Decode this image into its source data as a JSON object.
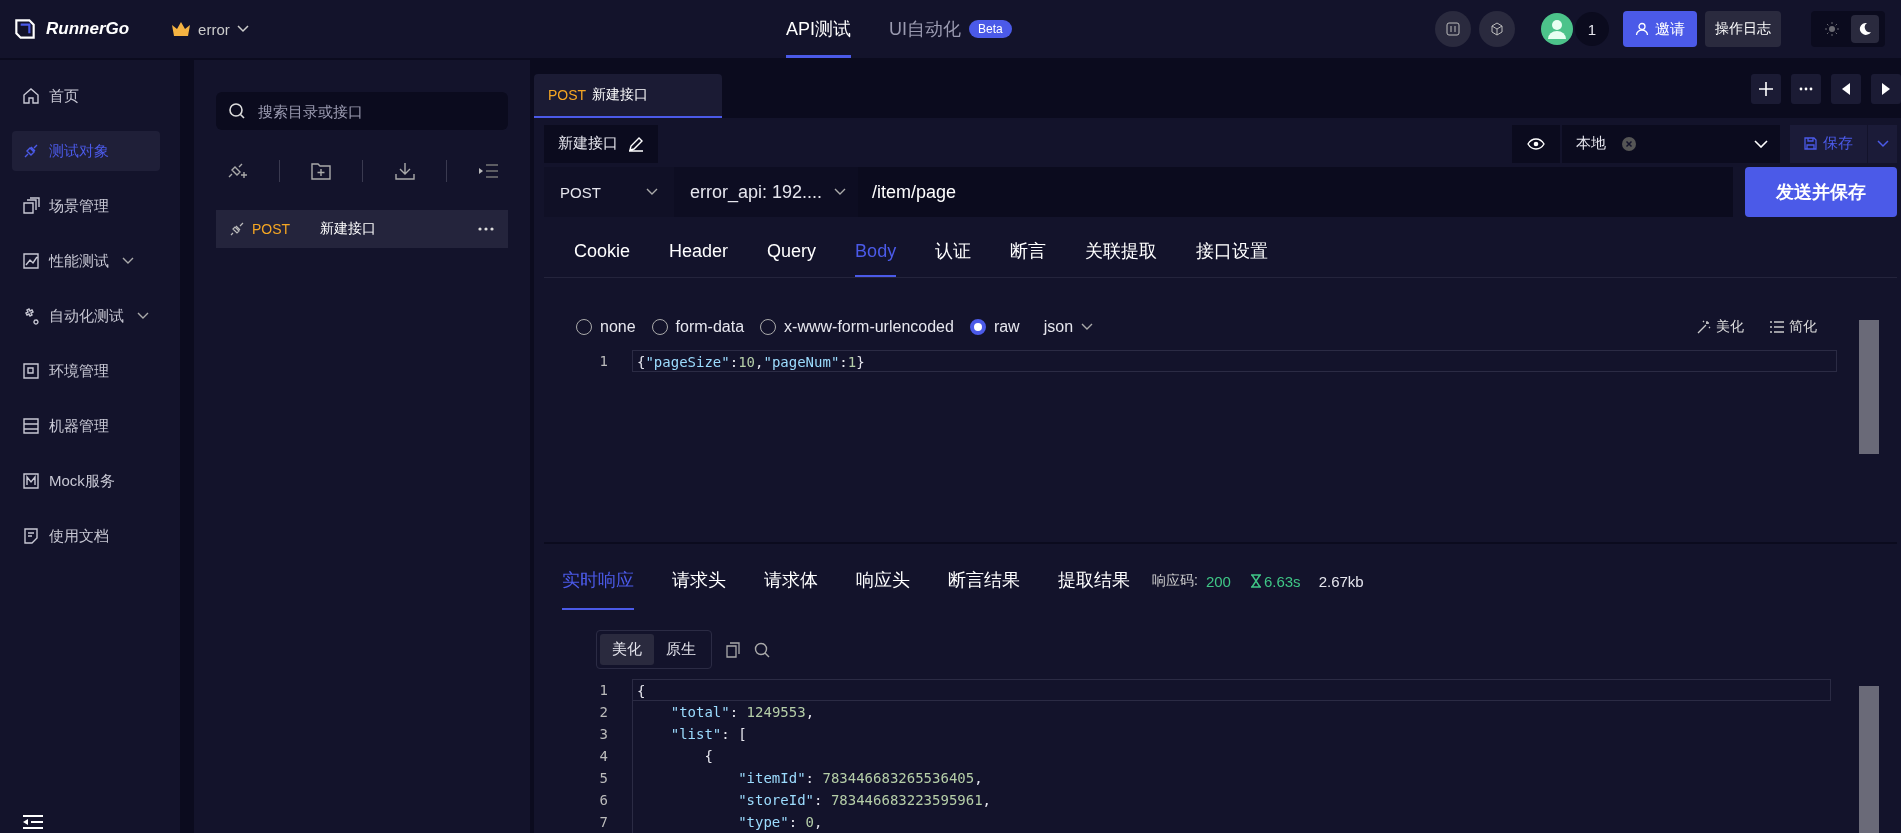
{
  "app": {
    "logo": "RunnerGo",
    "workspace": "error"
  },
  "nav_tabs": [
    {
      "label": "API测试",
      "selected": true
    },
    {
      "label": "UI自动化",
      "selected": false,
      "badge": "Beta"
    }
  ],
  "header": {
    "user_count": "1",
    "invite": "邀请",
    "log": "操作日志",
    "dark_theme": true
  },
  "sidebar": {
    "items": [
      {
        "label": "首页",
        "selected": false,
        "has_submenu": false
      },
      {
        "label": "测试对象",
        "selected": true,
        "has_submenu": false
      },
      {
        "label": "场景管理",
        "selected": false,
        "has_submenu": false
      },
      {
        "label": "性能测试",
        "selected": false,
        "has_submenu": true
      },
      {
        "label": "自动化测试",
        "selected": false,
        "has_submenu": true
      },
      {
        "label": "环境管理",
        "selected": false,
        "has_submenu": false
      },
      {
        "label": "机器管理",
        "selected": false,
        "has_submenu": false
      },
      {
        "label": "Mock服务",
        "selected": false,
        "has_submenu": false
      },
      {
        "label": "使用文档",
        "selected": false,
        "has_submenu": false
      }
    ]
  },
  "tree": {
    "search_placeholder": "搜索目录或接口",
    "items": [
      {
        "method": "POST",
        "name": "新建接口",
        "selected": true
      }
    ]
  },
  "open_tabs": [
    {
      "method": "POST",
      "name": "新建接口",
      "selected": true
    }
  ],
  "request": {
    "name": "新建接口",
    "env": "本地",
    "save": "保存",
    "method": "POST",
    "service": "error_api: 192....",
    "url": "/item/page",
    "send": "发送并保存"
  },
  "request_tabs": [
    {
      "label": "Cookie",
      "selected": false
    },
    {
      "label": "Header",
      "selected": false
    },
    {
      "label": "Query",
      "selected": false
    },
    {
      "label": "Body",
      "selected": true
    },
    {
      "label": "认证",
      "selected": false
    },
    {
      "label": "断言",
      "selected": false
    },
    {
      "label": "关联提取",
      "selected": false
    },
    {
      "label": "接口设置",
      "selected": false
    }
  ],
  "body_types": [
    {
      "label": "none",
      "selected": false
    },
    {
      "label": "form-data",
      "selected": false
    },
    {
      "label": "x-www-form-urlencoded",
      "selected": false
    },
    {
      "label": "raw",
      "selected": true
    }
  ],
  "body_format": "json",
  "beautify": "美化",
  "simplify": "简化",
  "body_lines": [
    {
      "no": "1",
      "text": "{\"pageSize\":10,\"pageNum\":1}"
    }
  ],
  "response_tabs": [
    {
      "label": "实时响应",
      "selected": true
    },
    {
      "label": "请求头",
      "selected": false
    },
    {
      "label": "请求体",
      "selected": false
    },
    {
      "label": "响应头",
      "selected": false
    },
    {
      "label": "断言结果",
      "selected": false
    },
    {
      "label": "提取结果",
      "selected": false
    }
  ],
  "status": {
    "label": "响应码:",
    "code": "200",
    "time": "6.63s",
    "size": "2.67kb"
  },
  "view_modes": [
    {
      "label": "美化",
      "selected": true
    },
    {
      "label": "原生",
      "selected": false
    }
  ],
  "response_lines": [
    {
      "no": "1",
      "text": "{"
    },
    {
      "no": "2",
      "text": "    \"total\": 1249553,"
    },
    {
      "no": "3",
      "text": "    \"list\": ["
    },
    {
      "no": "4",
      "text": "        {"
    },
    {
      "no": "5",
      "text": "            \"itemId\": 783446683265536405,"
    },
    {
      "no": "6",
      "text": "            \"storeId\": 783446683223595961,"
    },
    {
      "no": "7",
      "text": "            \"type\": 0,"
    }
  ]
}
